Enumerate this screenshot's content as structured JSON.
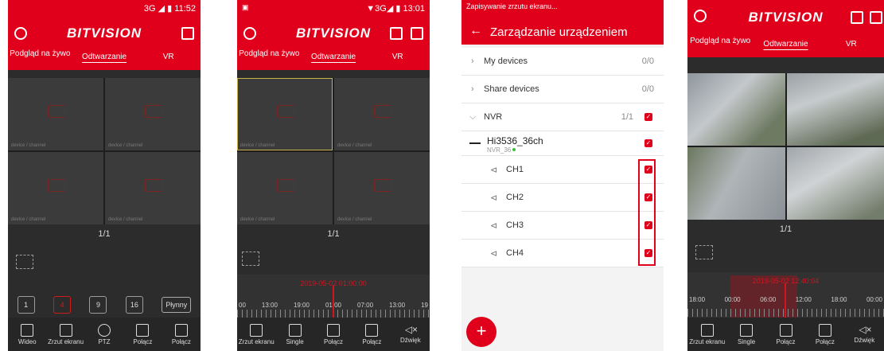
{
  "brand": "BITVISION",
  "colors": {
    "accent": "#e0001b",
    "dark": "#2c2c2c"
  },
  "screen1": {
    "status": "3G ◢ ▮ 11:52",
    "tabs": [
      "Podgląd na żywo",
      "Odtwarzanie",
      "VR"
    ],
    "cells": [
      "device / channel",
      "device / channel",
      "device / channel",
      "device / channel"
    ],
    "page": "1/1",
    "splits": [
      "1",
      "4",
      "9",
      "16"
    ],
    "fluency": "Płynny",
    "bottom": [
      "Wideo",
      "Zrzut ekranu",
      "PTZ",
      "Połącz",
      "Połącz"
    ]
  },
  "screen2": {
    "status": "▼3G◢ ▮ 13:01",
    "tabs": [
      "Podgląd na żywo",
      "Odtwarzanie",
      "VR"
    ],
    "cells": [
      "device / channel",
      "device / channel",
      "device / channel",
      "device / channel"
    ],
    "page": "1/1",
    "timestamp": "2019-05-02 01:00:00",
    "ticks": [
      "00",
      "13:00",
      "19:00",
      "01:00",
      "07:00",
      "13:00",
      "19"
    ],
    "bottom": [
      "Zrzut ekranu",
      "Single",
      "Połącz",
      "Połącz",
      "Dźwięk"
    ]
  },
  "screen3": {
    "status": "Zapisywanie zrzutu ekranu...",
    "title": "Zarządzanie urządzeniem",
    "rows": [
      {
        "label": "My devices",
        "count": "0/0"
      },
      {
        "label": "Share devices",
        "count": "0/0"
      },
      {
        "label": "NVR",
        "count": "1/1"
      }
    ],
    "device": {
      "name": "Hi3536_36ch",
      "sub": "NVR_36"
    },
    "channels": [
      "CH1",
      "CH2",
      "CH3",
      "CH4"
    ],
    "fab": "+"
  },
  "screen4": {
    "tabs": [
      "Podgląd na żywo",
      "Odtwarzanie",
      "VR"
    ],
    "page": "1/1",
    "timestamp": "2019-05-02 12:40:04",
    "ticks": [
      "18:00",
      "00:00",
      "06:00",
      "12:00",
      "18:00",
      "00:00"
    ],
    "bottom": [
      "Zrzut ekranu",
      "Single",
      "Połącz",
      "Połącz",
      "Dźwięk"
    ]
  }
}
